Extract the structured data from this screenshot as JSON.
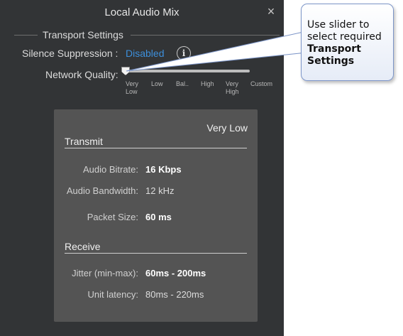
{
  "window": {
    "title": "Local Audio Mix",
    "close_symbol": "×"
  },
  "transport": {
    "section_title": "Transport Settings",
    "silence_label": "Silence Suppression :",
    "silence_value": "Disabled",
    "info_symbol": "i",
    "network_quality_label": "Network Quality:",
    "slider_level_index": 0,
    "ticks": [
      "Very\nLow",
      "Low",
      "Bal..",
      "High",
      "Very\nHigh",
      "Custom"
    ]
  },
  "details": {
    "quality_value": "Very Low",
    "transmit": {
      "heading": "Transmit",
      "bitrate_label": "Audio Bitrate:",
      "bitrate_value": "16 Kbps",
      "bandwidth_label": "Audio Bandwidth:",
      "bandwidth_value": "12 kHz",
      "packet_label": "Packet Size:",
      "packet_value": "60 ms"
    },
    "receive": {
      "heading": "Receive",
      "jitter_label": "Jitter (min-max):",
      "jitter_value": "60ms - 200ms",
      "latency_label": "Unit latency:",
      "latency_value": "80ms - 220ms"
    }
  },
  "callout": {
    "line1": "Use slider to",
    "line2": "select required",
    "line3": "Transport",
    "line4": "Settings"
  }
}
